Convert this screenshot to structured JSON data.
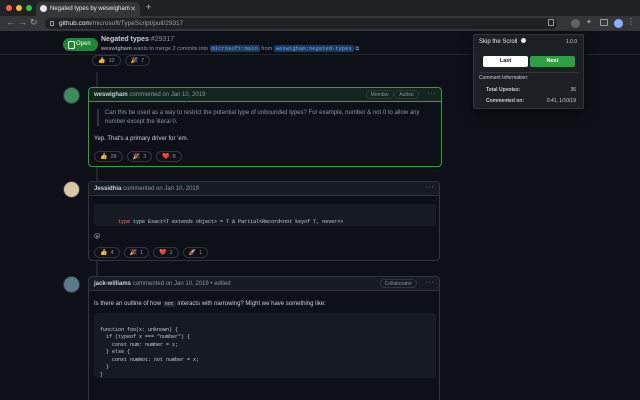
{
  "browser": {
    "tab_title": "Negated types by weswigham",
    "url_host": "github.com",
    "url_path": "/microsoft/TypeScript/pull/29317",
    "colors": {
      "close": "#ff5f57",
      "minimize": "#febc2e",
      "maximize": "#28c840"
    }
  },
  "pr": {
    "status": "Open",
    "title": "Negated types",
    "number": "#29317",
    "author": "weswigham",
    "merge_text": "wants to merge 2 commits into",
    "base_branch": "microsoft:main",
    "from_text": "from",
    "head_branch": "weswigham:negated-types"
  },
  "top_reactions": [
    {
      "icon": "thumbs-up-icon",
      "emoji": "👍",
      "count": "10"
    },
    {
      "icon": "party-icon",
      "emoji": "🎉",
      "count": "7"
    }
  ],
  "comments": [
    {
      "author": "weswigham",
      "meta": "commented on Jan 10, 2019",
      "badges": [
        "Member",
        "Author"
      ],
      "quote": "Can this be used as a way to restrict the potential type of unbounded types? For example, number & not 0 to allow any number except the literal 0.",
      "body": "Yep. That's a primary driver for 'em.",
      "reactions": [
        {
          "icon": "thumbs-up-icon",
          "emoji": "👍",
          "count": "28"
        },
        {
          "icon": "party-icon",
          "emoji": "🎉",
          "count": "3"
        },
        {
          "icon": "heart-icon",
          "emoji": "❤️",
          "count": "8"
        }
      ]
    },
    {
      "author": "Jessidhia",
      "meta": "commented on Jan 10, 2019",
      "code_line": "type Exact<T extends object> = T & Partial<Record<not keyof T, never>>",
      "trailing_emoji": "😮",
      "reactions": [
        {
          "icon": "thumbs-up-icon",
          "emoji": "👍",
          "count": "4"
        },
        {
          "icon": "party-icon",
          "emoji": "🎉",
          "count": "1"
        },
        {
          "icon": "heart-icon",
          "emoji": "❤️",
          "count": "2"
        },
        {
          "icon": "rocket-icon",
          "emoji": "🚀",
          "count": "1"
        }
      ]
    },
    {
      "author": "jack-williams",
      "meta": "commented on Jan 10, 2019 • edited",
      "badges": [
        "Collaborator"
      ],
      "body_before": "Is there an outline of how",
      "body_code": "not",
      "body_after": "interacts with narrowing? Might we have something like:",
      "code_lines": [
        "function foo(x: unknown) {",
        "  if (typeof x === \"number\") {",
        "    const num: number = x;",
        "  } else {",
        "    const numNot: not number = x;",
        "  }",
        "}"
      ]
    }
  ],
  "extension": {
    "title": "Skip the Scroll",
    "version": "1.0.0",
    "last_label": "Last",
    "next_label": "Next",
    "section_label": "Comment Information:",
    "upvotes_label": "Total Upvotes:",
    "upvotes_value": "36",
    "commented_label": "Commented on:",
    "commented_value": "0:41, 1/10/19",
    "next_color": "#2ea043"
  }
}
